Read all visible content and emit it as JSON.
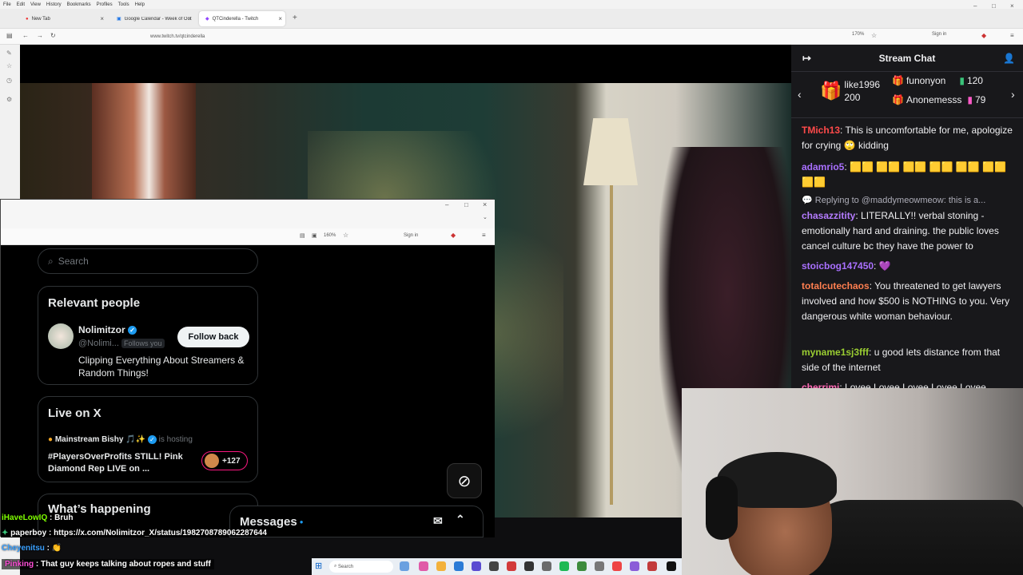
{
  "browser": {
    "menu": [
      "File",
      "Edit",
      "View",
      "History",
      "Bookmarks",
      "Profiles",
      "Tools",
      "Help"
    ],
    "tabs": [
      {
        "label": "New Tab"
      },
      {
        "label": "Google Calendar - Week of Oct"
      },
      {
        "label": "QTCinderella - Twitch"
      }
    ],
    "url": "www.twitch.tv/qtcinderella",
    "zoom": "170%",
    "sign_in": "Sign in"
  },
  "xwindow": {
    "zoom": "160%",
    "sign_in": "Sign in",
    "search_placeholder": "Search",
    "relevant_people": {
      "title": "Relevant people",
      "name": "Nolimitzor",
      "handle": "@Nolimi...",
      "follows_you": "Follows you",
      "follow_button": "Follow back",
      "bio": "Clipping Everything About Streamers & Random Things!"
    },
    "live": {
      "title": "Live on X",
      "host": "Mainstream Bishy 🎵✨",
      "hosting": "is hosting",
      "headline": "#PlayersOverProfits STILL! Pink Diamond Rep LIVE on ...",
      "count": "+127"
    },
    "happening": "What’s happening",
    "messages": "Messages"
  },
  "chat": {
    "title": "Stream Chat",
    "gifts": [
      {
        "name": "like1996",
        "count": "200"
      },
      {
        "name": "funonyon",
        "count": "120"
      },
      {
        "name": "Anonemesss",
        "count": "79"
      }
    ],
    "messages": [
      {
        "user": "TMich13",
        "color": "#ff4a4a",
        "text": "This is uncomfortable for me, apologize for crying 🙄 kidding"
      },
      {
        "user": "adamrio5",
        "color": "#a970ff",
        "text": "🟨🟨 🟨🟨 🟨🟨 🟨🟨 🟨🟨 🟨🟨 🟨🟨"
      },
      {
        "reply": "Replying to @maddymeowmeow: this is a..."
      },
      {
        "user": "chasazzitity",
        "color": "#b57cff",
        "text": "LITERALLY!! verbal stoning - emotionally hard and draining. the public loves cancel culture bc they have the power to"
      },
      {
        "user": "stoicbog147450",
        "color": "#a970ff",
        "text": "💜"
      },
      {
        "user": "totalcutechaos",
        "color": "#ff7f50",
        "text": "You threatened to get lawyers involved and how $500 is NOTHING to you. Very dangerous white woman behaviour."
      },
      {
        "user": "myname1sj3fff",
        "color": "#9acd32",
        "text": "u good lets distance from that side of the internet"
      },
      {
        "user": "cherrimi",
        "color": "#ff69b4",
        "text": "Lovee Lovee Lovee Lovee Lovee"
      }
    ]
  },
  "overlay": [
    {
      "user": "iHaveLowIQ",
      "text": "Bruh",
      "color": "#7fff00"
    },
    {
      "user": "paperboy",
      "text": "https://x.com/Nolimitzor_X/status/1982708789062287644",
      "color": "#ffffff"
    },
    {
      "user": "Cheyenitsu",
      "text": "👏",
      "color": "#3aa0ff"
    },
    {
      "user": "Pinking",
      "text": "That guy keeps talking about ropes and stuff",
      "color": "#ff4fd8"
    }
  ],
  "taskbar": {
    "search": "Search"
  }
}
